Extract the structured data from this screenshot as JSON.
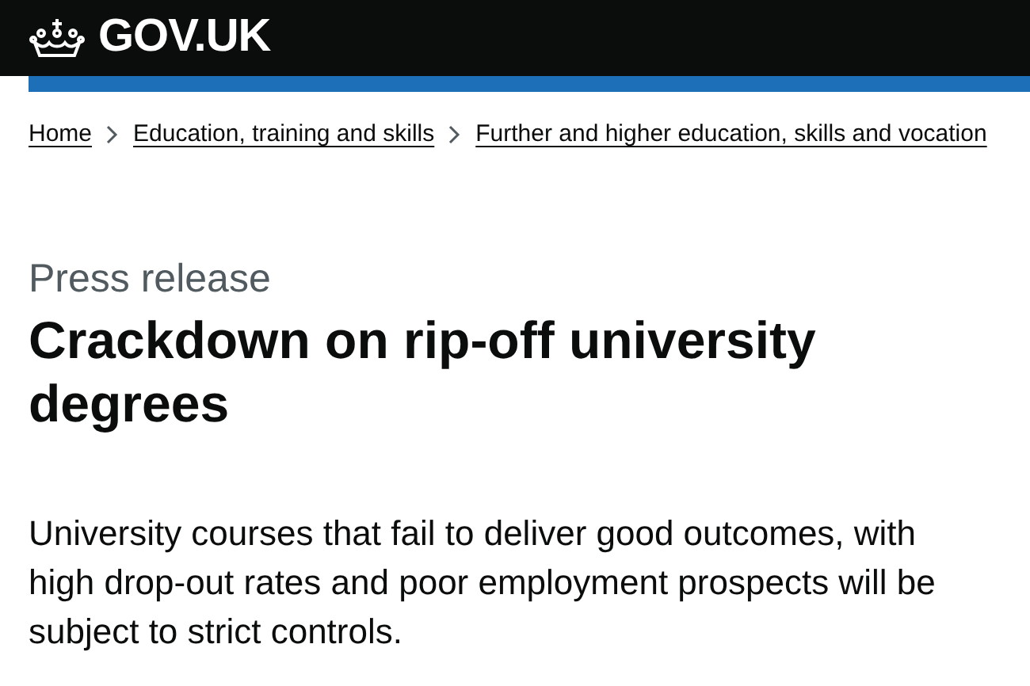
{
  "header": {
    "logo": "GOV.UK"
  },
  "breadcrumbs": [
    {
      "label": "Home"
    },
    {
      "label": "Education, training and skills"
    },
    {
      "label": "Further and higher education, skills and vocation"
    }
  ],
  "caption": "Press release",
  "title": "Crackdown on rip-off university degrees",
  "lead": "University courses that fail to deliver good outcomes, with high drop-out rates and poor employment prospects will be subject to strict controls."
}
